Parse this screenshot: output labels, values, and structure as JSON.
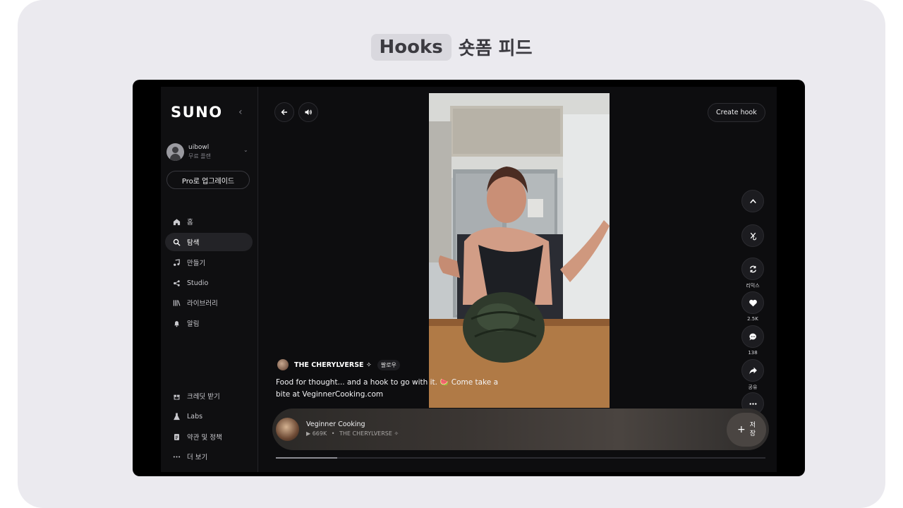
{
  "heading": {
    "pill": "Hooks",
    "rest": "숏폼 피드"
  },
  "sidebar": {
    "logo": "SUNO",
    "collapse_icon": "chevron-left-icon",
    "user": {
      "name": "uibowl",
      "plan": "무료 플랜"
    },
    "upgrade_label": "Pro로 업그레이드",
    "nav": [
      {
        "label": "홈",
        "icon": "home-icon"
      },
      {
        "label": "탐색",
        "icon": "search-icon",
        "active": true
      },
      {
        "label": "만들기",
        "icon": "music-note-icon"
      },
      {
        "label": "Studio",
        "icon": "studio-icon"
      },
      {
        "label": "라이브러리",
        "icon": "library-icon"
      },
      {
        "label": "알림",
        "icon": "bell-icon"
      }
    ],
    "bottom_nav": [
      {
        "label": "크레딧 받기",
        "icon": "gift-icon"
      },
      {
        "label": "Labs",
        "icon": "flask-icon"
      },
      {
        "label": "약관 및 정책",
        "icon": "document-icon"
      },
      {
        "label": "더 보기",
        "icon": "more-icon"
      }
    ]
  },
  "toolbar": {
    "create_hook": "Create hook"
  },
  "post": {
    "author": "THE CHERYLVERSE ✧",
    "follow": "팔로우",
    "caption": "Food for thought... and a hook to go with it. 🍉 Come take a bite at VeginnerCooking.com"
  },
  "actions": {
    "remix": "리믹스",
    "likes": "2.5K",
    "comments": "138",
    "share": "공유"
  },
  "player": {
    "title": "Veginner Cooking",
    "plays": "▶ 669K",
    "separator": "•",
    "artist": "THE CHERYLVERSE ✧",
    "save_plus": "+",
    "save_label_1": "저",
    "save_label_2": "장",
    "progress": 0.125
  }
}
